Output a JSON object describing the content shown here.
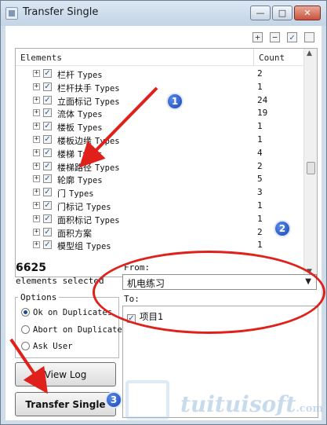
{
  "window": {
    "title": "Transfer Single"
  },
  "grid": {
    "header": {
      "elements": "Elements",
      "count": "Count"
    },
    "rows": [
      {
        "name": "栏杆",
        "suffix": "Types",
        "count": "2"
      },
      {
        "name": "栏杆扶手",
        "suffix": "Types",
        "count": "1"
      },
      {
        "name": "立面标记",
        "suffix": "Types",
        "count": "24"
      },
      {
        "name": "流体",
        "suffix": "Types",
        "count": "19"
      },
      {
        "name": "楼板",
        "suffix": "Types",
        "count": "1"
      },
      {
        "name": "楼板边缘",
        "suffix": "Types",
        "count": "1"
      },
      {
        "name": "楼梯",
        "suffix": "Types",
        "count": "4"
      },
      {
        "name": "楼梯路径",
        "suffix": "Types",
        "count": "2"
      },
      {
        "name": "轮廓",
        "suffix": "Types",
        "count": "5"
      },
      {
        "name": "门",
        "suffix": "Types",
        "count": "3"
      },
      {
        "name": "门标记",
        "suffix": "Types",
        "count": "1"
      },
      {
        "name": "面积标记",
        "suffix": "Types",
        "count": "1"
      },
      {
        "name": "面积方案",
        "suffix": "",
        "count": "2"
      },
      {
        "name": "模型组",
        "suffix": "Types",
        "count": "1"
      }
    ]
  },
  "selection": {
    "count": "6625",
    "label": "elements selected"
  },
  "options": {
    "legend": "Options",
    "radios": [
      {
        "label": "Ok on Duplicates",
        "checked": true
      },
      {
        "label": "Abort on Duplicate",
        "checked": false
      },
      {
        "label": "Ask User",
        "checked": false
      }
    ]
  },
  "buttons": {
    "view_log": "View Log",
    "transfer": "Transfer Single"
  },
  "from": {
    "label": "From:",
    "value": "机电练习"
  },
  "to": {
    "label": "To:",
    "items": [
      {
        "name": "项目1",
        "checked": true
      }
    ]
  },
  "annotations": {
    "badge1": "1",
    "badge2": "2",
    "badge3": "3",
    "accent": "#e0201b"
  },
  "watermark": {
    "text": "tuituisoft",
    "suffix": ".com"
  },
  "icons": [
    "expand-all-icon",
    "collapse-all-icon",
    "check-all-icon",
    "uncheck-all-icon"
  ]
}
